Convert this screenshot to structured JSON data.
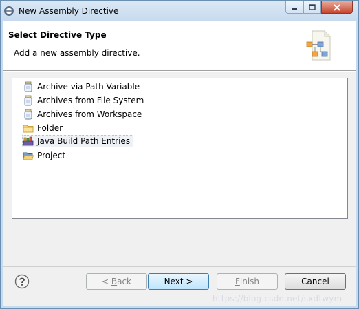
{
  "window": {
    "title": "New Assembly Directive",
    "minimize_icon": "minimize-icon",
    "maximize_icon": "maximize-icon",
    "close_icon": "close-icon"
  },
  "header": {
    "title": "Select Directive Type",
    "description": "Add a new assembly directive."
  },
  "list": {
    "items": [
      {
        "label": "Archive via Path Variable",
        "icon": "jar-icon"
      },
      {
        "label": "Archives from File System",
        "icon": "jar-icon"
      },
      {
        "label": "Archives from Workspace",
        "icon": "jar-icon"
      },
      {
        "label": "Folder",
        "icon": "folder-icon"
      },
      {
        "label": "Java Build Path Entries",
        "icon": "library-icon",
        "selected": true
      },
      {
        "label": "Project",
        "icon": "project-folder-icon"
      }
    ]
  },
  "buttons": {
    "back": {
      "prefix": "< ",
      "mnemonic": "B",
      "rest": "ack",
      "enabled": false
    },
    "next": {
      "label": "Next >",
      "enabled": true
    },
    "finish": {
      "mnemonic": "F",
      "rest": "inish",
      "enabled": false
    },
    "cancel": {
      "label": "Cancel",
      "enabled": true
    }
  },
  "watermark": "https://blog.csdn.net/sxdtwym",
  "colors": {
    "titlebar": "#c6daee",
    "dialog_bg": "#f0f0f0",
    "default_button": "#bee6fd",
    "close_button": "#c6452b"
  }
}
